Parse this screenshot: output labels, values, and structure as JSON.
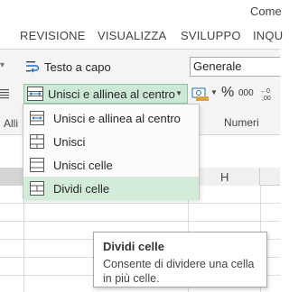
{
  "title": "Come",
  "tabs": [
    "REVISIONE",
    "VISUALIZZA",
    "SVILUPPO",
    "INQU"
  ],
  "alignment": {
    "wrap_text_label": "Testo a capo",
    "merge_center_label": "Unisci e allinea al centro",
    "group_label_partial": "Alli"
  },
  "number": {
    "format_value": "Generale",
    "percent_symbol": "%",
    "thousands_symbol": "000",
    "group_label": "Numeri"
  },
  "merge_menu": {
    "items": [
      {
        "label": "Unisci e allinea al centro",
        "icon": "merge-center-icon"
      },
      {
        "label": "Unisci",
        "icon": "merge-across-icon"
      },
      {
        "label": "Unisci celle",
        "icon": "merge-cells-icon"
      },
      {
        "label": "Dividi celle",
        "icon": "unmerge-cells-icon"
      }
    ],
    "hovered_index": 3
  },
  "sheet": {
    "visible_column": "H"
  },
  "tooltip": {
    "title": "Dividi celle",
    "body": "Consente di dividere una cella in più celle."
  },
  "colors": {
    "accent_green_bg": "#cde8d6",
    "accent_green_border": "#8fc5a2",
    "menu_hover": "#d3ecd9",
    "ribbon_bg": "#f4f4f4"
  }
}
